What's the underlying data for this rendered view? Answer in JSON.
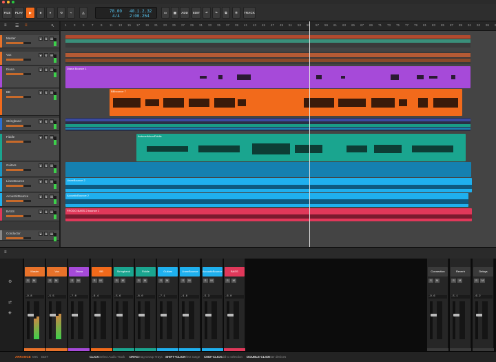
{
  "toolbar": {
    "file_label": "FILE",
    "play_label": "PLAY",
    "tempo": "78.00",
    "signature": "4/4",
    "position_bars": "40.1.2.32",
    "position_time": "2:00.254",
    "add_label": "ADD",
    "edit_label": "EDIT",
    "track_label": "TRACK"
  },
  "ruler": [
    "1",
    "3",
    "5",
    "7",
    "9",
    "11",
    "13",
    "15",
    "17",
    "19",
    "21",
    "23",
    "25",
    "27",
    "29",
    "31",
    "33",
    "35",
    "37",
    "39",
    "41",
    "43",
    "45",
    "47",
    "49",
    "51",
    "53",
    "55",
    "57",
    "59",
    "61",
    "63",
    "65",
    "67",
    "69",
    "71",
    "73",
    "75",
    "77",
    "79",
    "81",
    "83",
    "85",
    "87",
    "89",
    "91",
    "93",
    "95",
    "97"
  ],
  "tracks": [
    {
      "name": "Master",
      "color": "#e8722a"
    },
    {
      "name": "Vox",
      "color": "#e8722a"
    },
    {
      "name": "Diana",
      "color": "#a64ad9"
    },
    {
      "name": "BB",
      "color": "#f26a1b"
    },
    {
      "name": "Stringband",
      "color": "#2b6fd1"
    },
    {
      "name": "Fiddle",
      "color": "#1aa58f"
    },
    {
      "name": "Guitars",
      "color": "#1996c4"
    },
    {
      "name": "LineeBounce",
      "color": "#1fb0ee"
    },
    {
      "name": "AcousticBounce",
      "color": "#1fb0ee"
    },
    {
      "name": "BASS",
      "color": "#e0385a"
    },
    {
      "name": "Conductor",
      "color": "#888888"
    }
  ],
  "clips": {
    "diana": "Diana Bounce 1",
    "bb": "BBbounce 7",
    "fiddle": "AutumnMoonFiddle",
    "linee": "LineeBounce 2",
    "acoustic": "AcousticBounce 2",
    "bass": "FRODO BASS 2 bounce 1"
  },
  "mixer": {
    "strips": [
      {
        "name": "Master",
        "color": "#e8722a",
        "db": "-9.8",
        "l": 0.55,
        "r": 0.6
      },
      {
        "name": "Vox",
        "color": "#e8722a",
        "db": "-5.5",
        "l": 0.62,
        "r": 0.68
      },
      {
        "name": "Diana",
        "color": "#a64ad9",
        "db": "-7.0",
        "l": 0.0,
        "r": 0.0
      },
      {
        "name": "BB",
        "color": "#f26a1b",
        "db": "-6.4",
        "l": 0.0,
        "r": 0.0
      },
      {
        "name": "Stringband",
        "color": "#1aa58f",
        "db": "-5.6",
        "l": 0.0,
        "r": 0.0
      },
      {
        "name": "Fiddle",
        "color": "#1aa58f",
        "db": "-8.0",
        "l": 0.0,
        "r": 0.0
      },
      {
        "name": "Guitars",
        "color": "#1fb0ee",
        "db": "-7.1",
        "l": 0.0,
        "r": 0.0
      },
      {
        "name": "LineeBounce",
        "color": "#1fb0ee",
        "db": "-4.8",
        "l": 0.0,
        "r": 0.0
      },
      {
        "name": "AcousticBounce",
        "color": "#1fb0ee",
        "db": "-5.3",
        "l": 0.0,
        "r": 0.0
      },
      {
        "name": "BASS",
        "color": "#e0385a",
        "db": "-6.0",
        "l": 0.0,
        "r": 0.0
      }
    ],
    "fx": [
      {
        "name": "Connection",
        "db": "-9.6"
      },
      {
        "name": "Reverb",
        "db": "-5.1"
      },
      {
        "name": "Delays",
        "db": "-6.2"
      }
    ]
  },
  "status": {
    "arrange": "ARRANGE",
    "mix": "MIX",
    "edit": "EDIT",
    "click": "CLICK",
    "click_desc": "Select Audio Track",
    "drag": "DRAG",
    "drag_desc": "Drag Group Trays",
    "shift_click": "SHIFT+CLICK",
    "shift_desc": "Select range",
    "cmd_click": "CMD+CLICK",
    "cmd_desc": "Add to selection",
    "dbl_click": "DOUBLE-CLICK",
    "dbl_desc": "Enter devices"
  }
}
